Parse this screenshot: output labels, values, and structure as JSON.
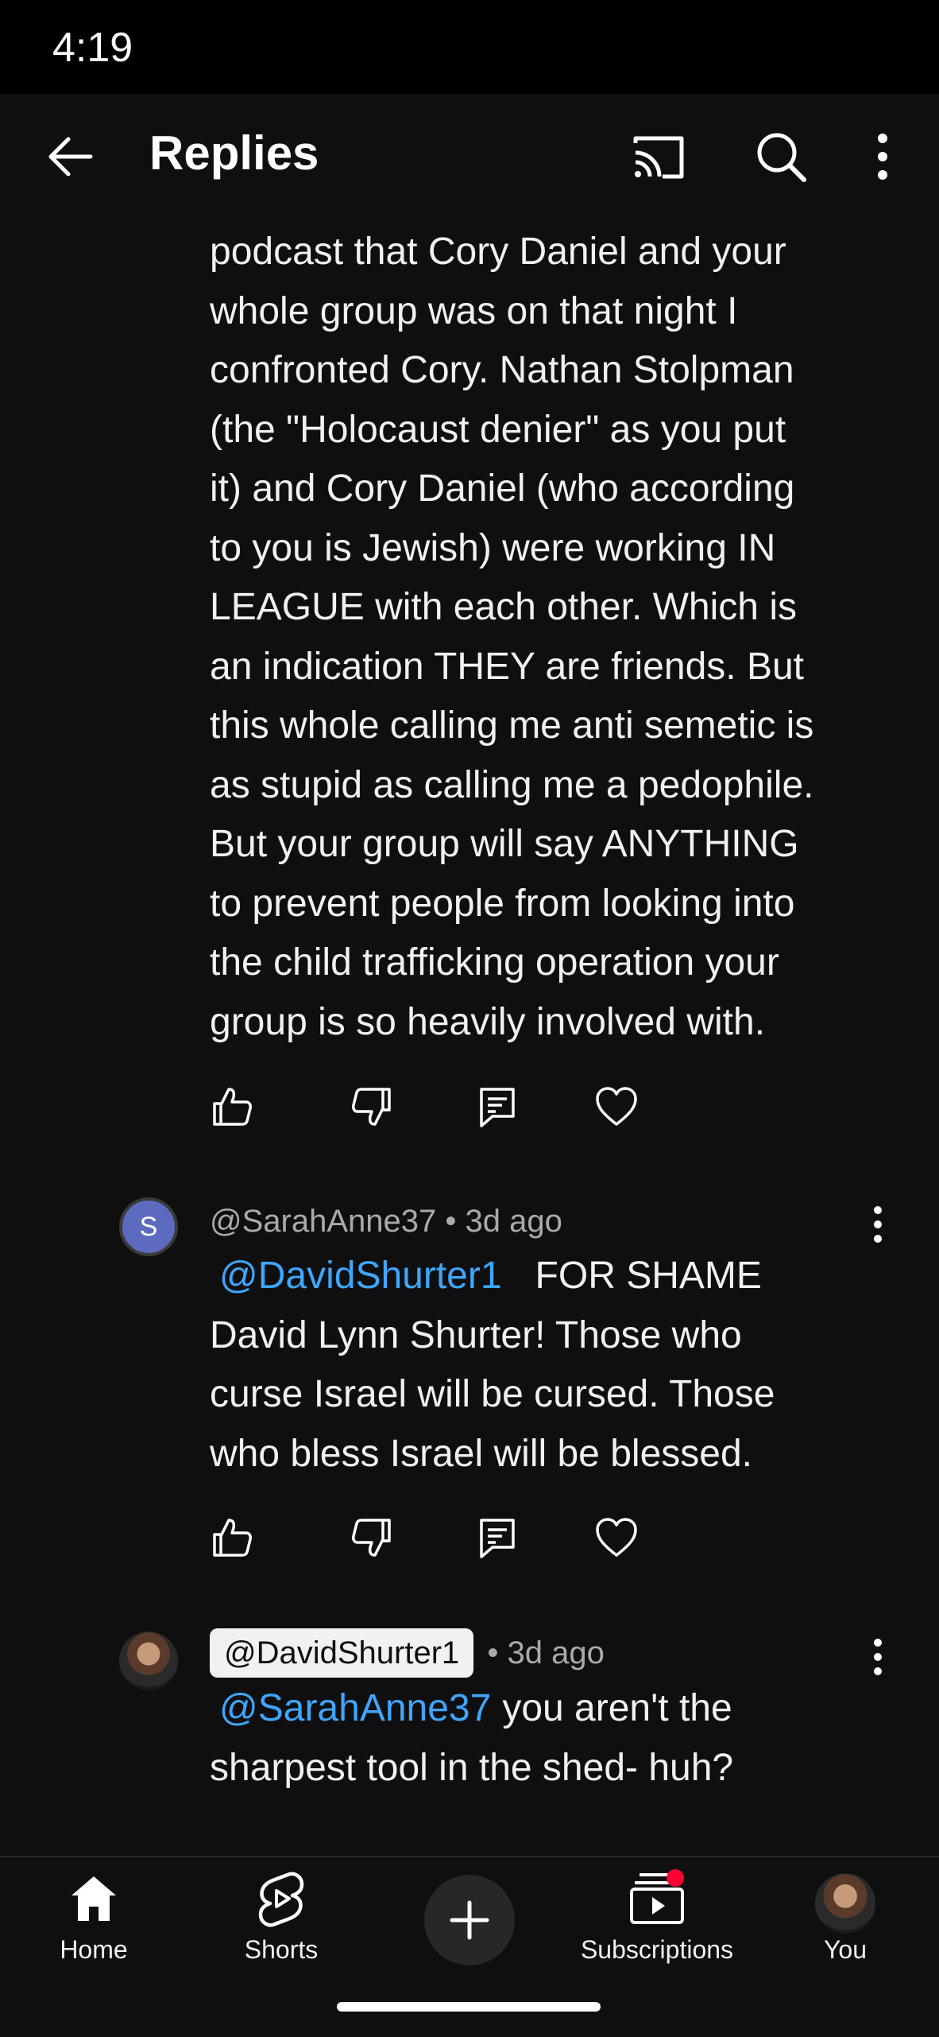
{
  "status": {
    "time": "4:19"
  },
  "header": {
    "title": "Replies"
  },
  "comments": [
    {
      "lines": [
        "podcast that Cory Daniel and your",
        "whole group was on that night I",
        "confronted Cory. Nathan Stolpman",
        "(the \"Holocaust denier\" as you put",
        "it) and Cory Daniel (who according",
        "to you is Jewish) were working IN",
        "LEAGUE with each other. Which is",
        "an indication THEY are friends. But",
        "this whole calling me anti semetic is",
        "as stupid as calling me a pedophile.",
        "But your group will say ANYTHING",
        "to prevent people from looking into",
        "the child trafficking operation your",
        "group is so heavily involved with."
      ]
    },
    {
      "author": "@SarahAnne37",
      "age": "• 3d ago",
      "avatar_letter": "S",
      "mention": "@DavidShurter1",
      "first_line_rest": "FOR SHAME",
      "lines": [
        "David Lynn Shurter! Those who",
        "curse Israel will be cursed. Those",
        "who bless Israel will be blessed."
      ]
    },
    {
      "author": "@DavidShurter1",
      "age": "• 3d ago",
      "mention": "@SarahAnne37",
      "first_line_rest": "you aren't the",
      "lines": [
        "sharpest tool in the shed- huh?"
      ]
    }
  ],
  "nav": {
    "home": "Home",
    "shorts": "Shorts",
    "subscriptions": "Subscriptions",
    "you": "You"
  },
  "colors": {
    "background": "#0f0f0f",
    "mention": "#3ea6ff",
    "notification_dot": "#ff0033"
  }
}
